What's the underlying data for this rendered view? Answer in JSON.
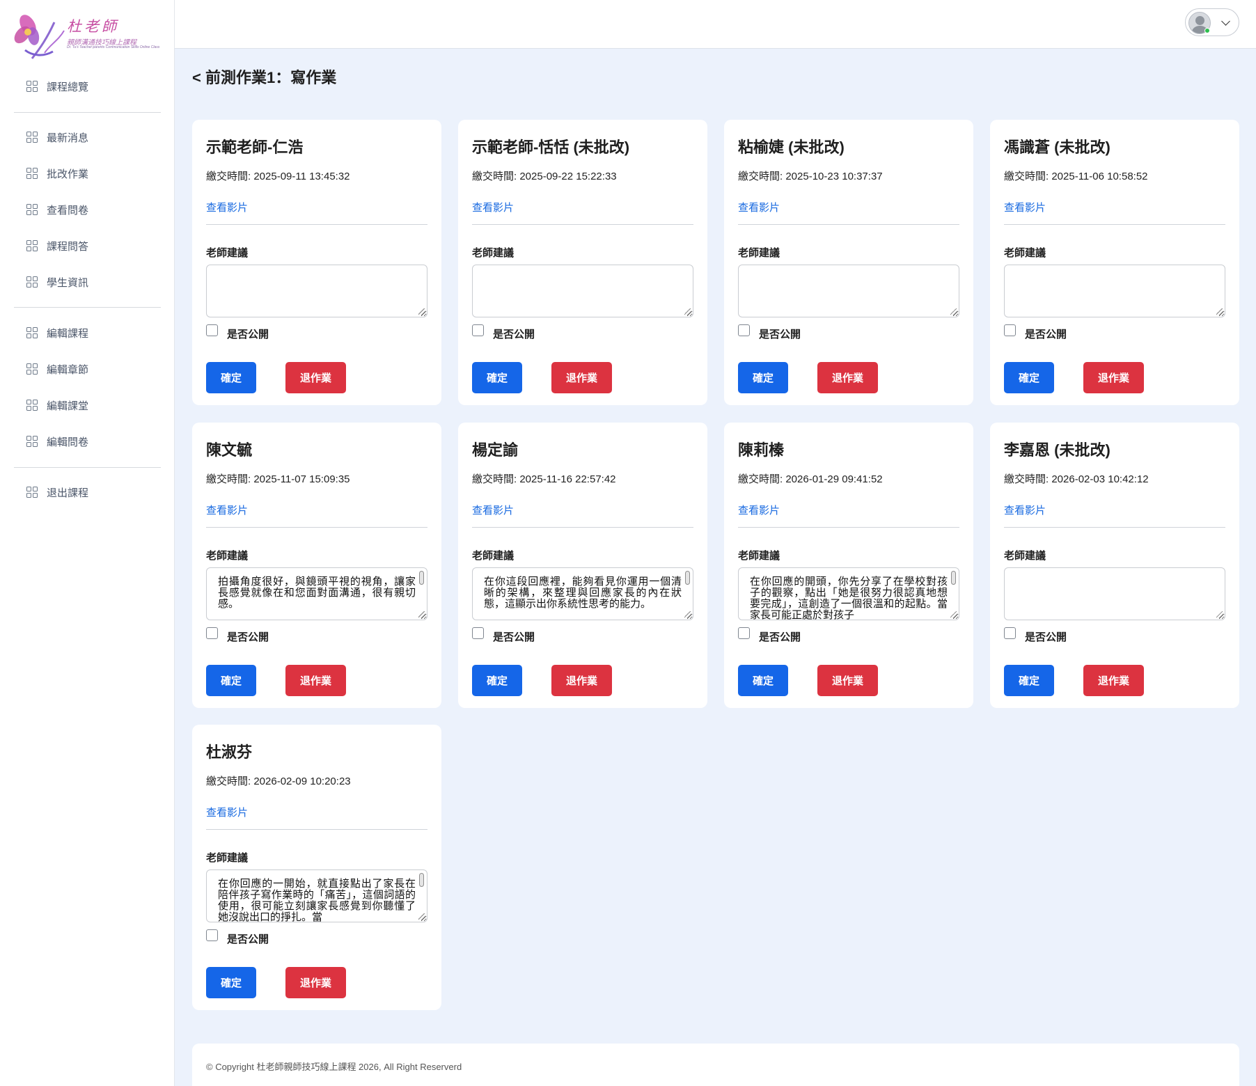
{
  "brand": {
    "title": "杜老師",
    "subtitle": "親師溝通技巧線上課程",
    "subtitle_en": "Dr. Tu's Teacher-parents Communication Skills Online Class"
  },
  "sidebar": {
    "groups": [
      [
        {
          "label": "課程總覽",
          "icon": "grid-icon"
        }
      ],
      [
        {
          "label": "最新消息",
          "icon": "grid-icon"
        },
        {
          "label": "批改作業",
          "icon": "grid-icon"
        },
        {
          "label": "查看問卷",
          "icon": "grid-icon"
        },
        {
          "label": "課程問答",
          "icon": "grid-icon"
        },
        {
          "label": "學生資訊",
          "icon": "grid-icon"
        }
      ],
      [
        {
          "label": "編輯課程",
          "icon": "grid-icon"
        },
        {
          "label": "編輯章節",
          "icon": "grid-icon"
        },
        {
          "label": "編輯課堂",
          "icon": "grid-icon"
        },
        {
          "label": "編輯問卷",
          "icon": "grid-icon"
        }
      ],
      [
        {
          "label": "退出課程",
          "icon": "grid-icon"
        }
      ]
    ]
  },
  "header": {
    "title": "< 前測作業1：寫作業"
  },
  "labels": {
    "submit_prefix": "繳交時間: ",
    "view_video": "查看影片",
    "teacher_advice": "老師建議",
    "public": "是否公開",
    "confirm": "確定",
    "return": "退作業"
  },
  "submissions": [
    {
      "name": "示範老師-仁浩",
      "time": "2025-09-11 13:45:32",
      "advice": ""
    },
    {
      "name": "示範老師-恬恬 (未批改)",
      "time": "2025-09-22 15:22:33",
      "advice": ""
    },
    {
      "name": "粘榆婕 (未批改)",
      "time": "2025-10-23 10:37:37",
      "advice": ""
    },
    {
      "name": "馮識蒼 (未批改)",
      "time": "2025-11-06 10:58:52",
      "advice": ""
    },
    {
      "name": "陳文毓",
      "time": "2025-11-07 15:09:35",
      "advice": "拍攝角度很好，與鏡頭平視的視角，讓家長感覺就像在和您面對面溝通，很有親切感。"
    },
    {
      "name": "楊定諭",
      "time": "2025-11-16 22:57:42",
      "advice": "在你這段回應裡，能夠看見你運用一個清晰的架構，來整理與回應家長的內在狀態，這顯示出你系統性思考的能力。"
    },
    {
      "name": "陳莉榛",
      "time": "2026-01-29 09:41:52",
      "advice": "在你回應的開頭，你先分享了在學校對孩子的觀察，點出「她是很努力很認真地想要完成」，這創造了一個很溫和的起點。當家長可能正處於對孩子"
    },
    {
      "name": "李嘉恩 (未批改)",
      "time": "2026-02-03 10:42:12",
      "advice": ""
    },
    {
      "name": "杜淑芬",
      "time": "2026-02-09 10:20:23",
      "advice": "在你回應的一開始，就直接點出了家長在陪伴孩子寫作業時的「痛苦」，這個詞語的使用，很可能立刻讓家長感覺到你聽懂了她沒說出口的掙扎。當"
    }
  ],
  "footer": {
    "copyright": "© Copyright 杜老師親師技巧線上課程 2026, All Right Reserverd"
  }
}
